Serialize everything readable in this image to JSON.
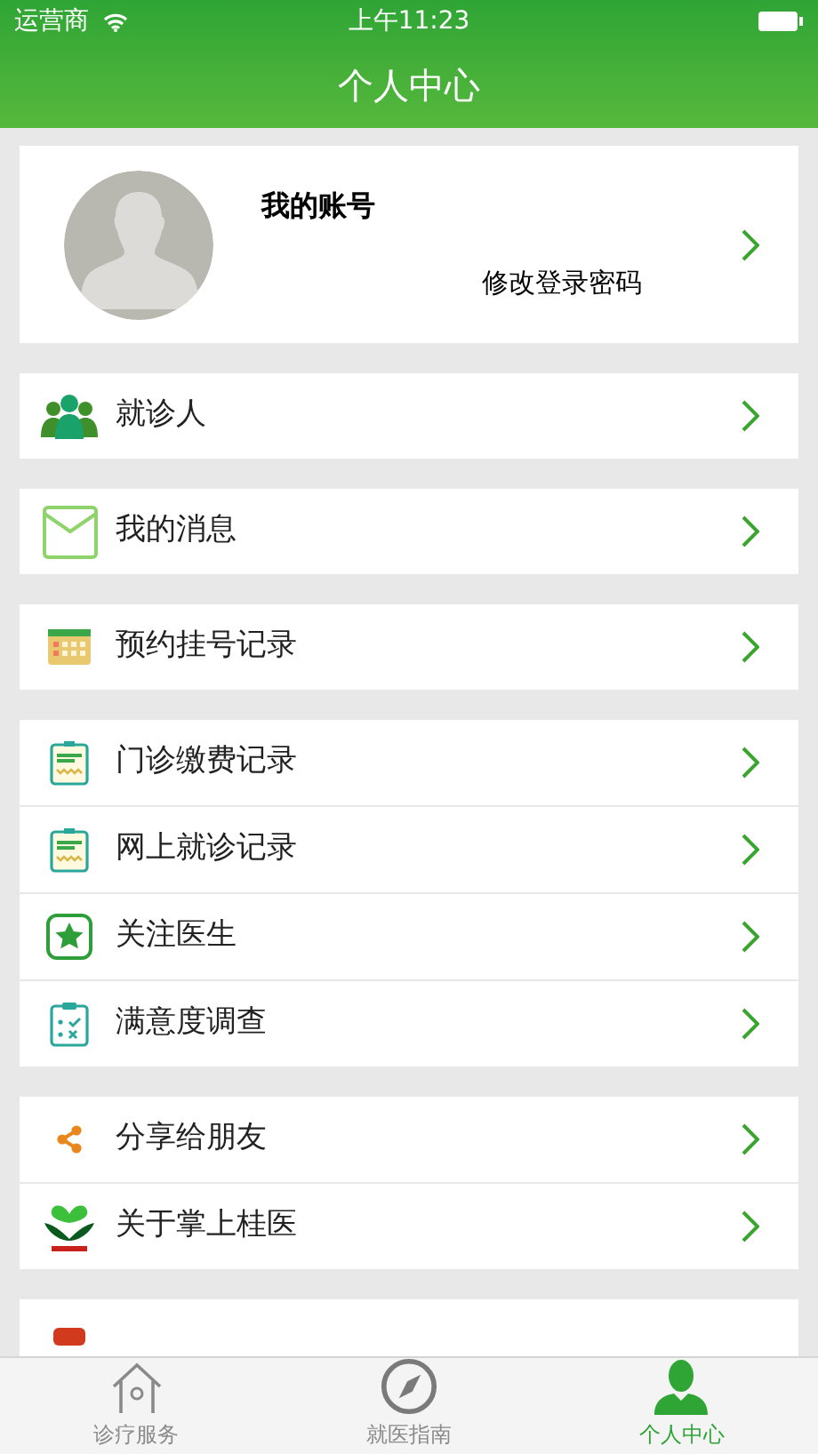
{
  "status_bar": {
    "carrier": "运营商",
    "time": "上午11:23"
  },
  "header": {
    "title": "个人中心"
  },
  "profile": {
    "title": "我的账号",
    "link": "修改登录密码"
  },
  "groups": [
    [
      {
        "label": "就诊人",
        "kind": "people"
      }
    ],
    [
      {
        "label": "我的消息",
        "kind": "mail"
      }
    ],
    [
      {
        "label": "预约挂号记录",
        "kind": "calendar"
      }
    ],
    [
      {
        "label": "门诊缴费记录",
        "kind": "chart"
      },
      {
        "label": "网上就诊记录",
        "kind": "chart"
      },
      {
        "label": "关注医生",
        "kind": "star"
      },
      {
        "label": "满意度调查",
        "kind": "survey"
      }
    ],
    [
      {
        "label": "分享给朋友",
        "kind": "share"
      },
      {
        "label": "关于掌上桂医",
        "kind": "logo"
      }
    ],
    [
      {
        "kind": "logout"
      }
    ]
  ],
  "tabs": [
    {
      "label": "诊疗服务",
      "kind": "home",
      "selected": false
    },
    {
      "label": "就医指南",
      "kind": "compass",
      "selected": false
    },
    {
      "label": "个人中心",
      "kind": "person",
      "selected": true
    }
  ]
}
